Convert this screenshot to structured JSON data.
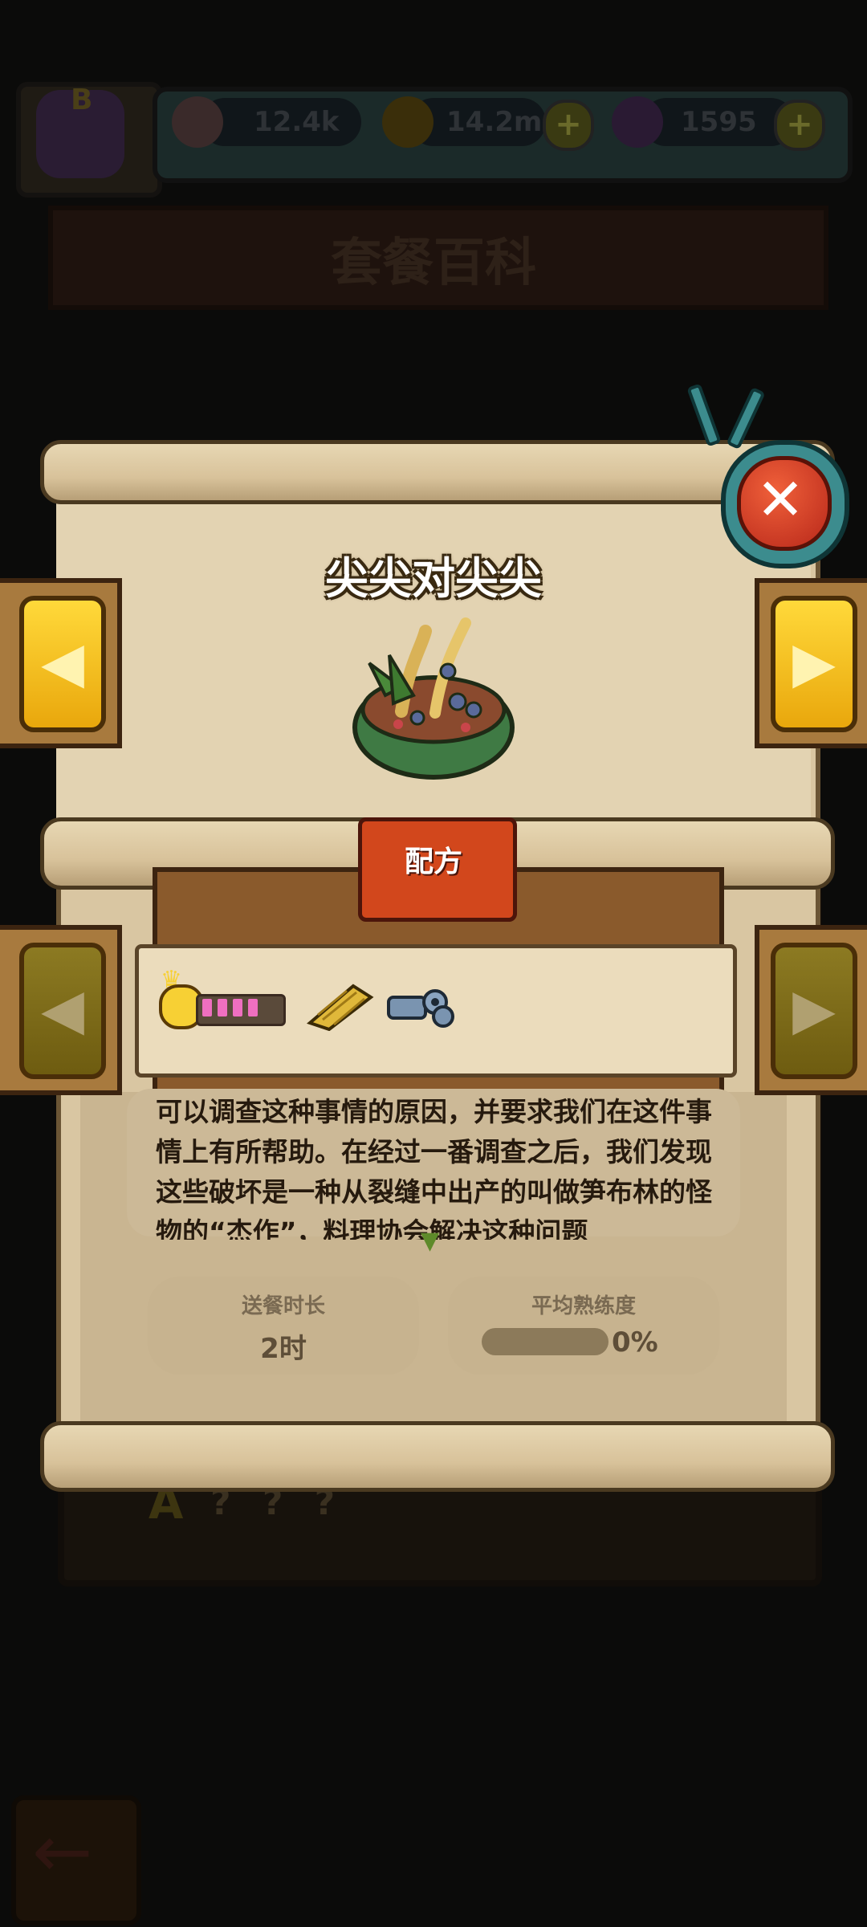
{
  "header": {
    "resources": [
      {
        "name": "eyeball",
        "value": "12.4k"
      },
      {
        "name": "coin",
        "value": "14.2m"
      },
      {
        "name": "potion",
        "value": "1595"
      }
    ],
    "rank_badge": "B"
  },
  "page_title": "套餐百科",
  "background": {
    "grade": "A",
    "hidden_name": "? ? ?"
  },
  "popup": {
    "dish_name": "尖尖对尖尖",
    "recipe_tab": "配方",
    "recipe": {
      "level_filled": 4,
      "level_total": 5,
      "ingredients": [
        "bamboo-shoot-icon",
        "bolt-nut-icon"
      ]
    },
    "description": "可以调查这种事情的原因，并要求我们在这件事情上有所帮助。在经过一番调查之后，我们发现这些破坏是一种从裂缝中出产的叫做笋布林的怪物的“杰作”，料理协会解决这种问题",
    "stats": {
      "delivery_label": "送餐时长",
      "delivery_value": "2时",
      "proficiency_label": "平均熟练度",
      "proficiency_value": "0%",
      "proficiency_fraction": 0
    }
  },
  "colors": {
    "arrow_button": "#f2bf1c",
    "ribbon": "#d2471c",
    "close_button": "#e04a2a",
    "level_bar": "#ef6fc0"
  }
}
